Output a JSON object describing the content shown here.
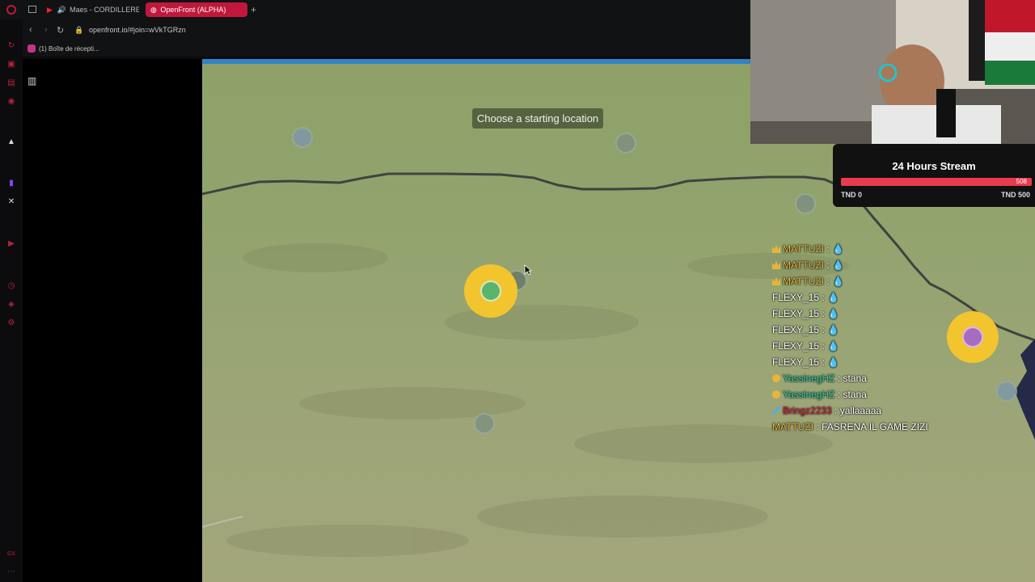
{
  "browser": {
    "tabs": [
      {
        "label": "Maes - CORDILLERE (",
        "active": false
      },
      {
        "label": "OpenFront (ALPHA)",
        "active": true
      }
    ],
    "new_tab": "+",
    "url": "openfront.io/#join=wVkTGRzn",
    "bookmarks": [
      {
        "label": "(1) Boîte de récepti..."
      }
    ]
  },
  "game": {
    "banner": "Choose a starting location",
    "map_colors": {
      "land": "#93a46f",
      "border": "#3f4340",
      "player": "#f2c42e",
      "player_inner": "#59b56b",
      "enemy_inner": "#a86bc2",
      "empty_spot": "#7e9080"
    }
  },
  "stream_goal": {
    "title": "24 Hours Stream",
    "current": "508",
    "min_label": "TND 0",
    "max_label": "TND 500",
    "progress": 1.0,
    "bar_color": "#e83b4f"
  },
  "chat": [
    {
      "badge": "crown",
      "user": "MATTUZI",
      "sep": " : ",
      "message": "💧",
      "color": "#e8b53a"
    },
    {
      "badge": "crown",
      "user": "MATTUZI",
      "sep": " : ",
      "message": "💧",
      "color": "#e8b53a"
    },
    {
      "badge": "crown",
      "user": "MATTUZI",
      "sep": " : ",
      "message": "💧",
      "color": "#e8b53a"
    },
    {
      "badge": "",
      "user": "FLEXY_15",
      "sep": " : ",
      "message": "💧",
      "color": "#ffffff"
    },
    {
      "badge": "",
      "user": "FLEXY_15",
      "sep": " : ",
      "message": "💧",
      "color": "#ffffff"
    },
    {
      "badge": "",
      "user": "FLEXY_15",
      "sep": " : ",
      "message": "💧",
      "color": "#ffffff"
    },
    {
      "badge": "",
      "user": "FLEXY_15",
      "sep": " : ",
      "message": "💧",
      "color": "#ffffff"
    },
    {
      "badge": "",
      "user": "FLEXY_15",
      "sep": " : ",
      "message": "💧",
      "color": "#ffffff"
    },
    {
      "badge": "coin",
      "user": "YassinegHZ",
      "sep": " : ",
      "message": "stana",
      "color": "#2fd3a9"
    },
    {
      "badge": "coin",
      "user": "YassinegHZ",
      "sep": " : ",
      "message": "stana",
      "color": "#2fd3a9"
    },
    {
      "badge": "sword",
      "user": "Bringz2233",
      "sep": " : ",
      "message": "yallaaaaa",
      "color": "#e0203f"
    },
    {
      "badge": "",
      "user": "MATTUZI",
      "sep": " : ",
      "message": "FASRENA IL GAME ZIZI",
      "color": "#e8b53a"
    }
  ]
}
